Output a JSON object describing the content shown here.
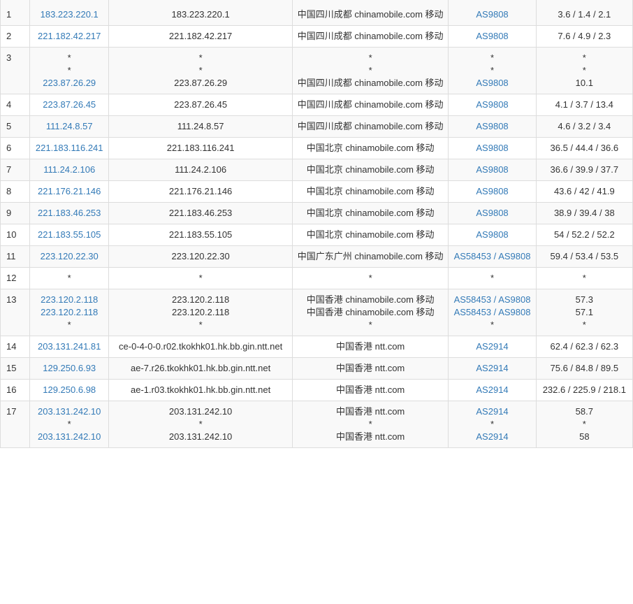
{
  "rows": [
    {
      "hop": "1",
      "ip": [
        "183.223.220.1"
      ],
      "host": [
        "183.223.220.1"
      ],
      "loc": [
        "中国四川成都 chinamobile.com 移动"
      ],
      "asn": [
        "AS9808"
      ],
      "rtt": [
        "3.6 / 1.4 / 2.1"
      ]
    },
    {
      "hop": "2",
      "ip": [
        "221.182.42.217"
      ],
      "host": [
        "221.182.42.217"
      ],
      "loc": [
        "中国四川成都 chinamobile.com 移动"
      ],
      "asn": [
        "AS9808"
      ],
      "rtt": [
        "7.6 / 4.9 / 2.3"
      ]
    },
    {
      "hop": "3",
      "ip": [
        "*",
        "*",
        "223.87.26.29"
      ],
      "host": [
        "*",
        "*",
        "223.87.26.29"
      ],
      "loc": [
        "*",
        "*",
        "中国四川成都 chinamobile.com 移动"
      ],
      "asn": [
        "*",
        "*",
        "AS9808"
      ],
      "rtt": [
        "*",
        "*",
        "10.1"
      ]
    },
    {
      "hop": "4",
      "ip": [
        "223.87.26.45"
      ],
      "host": [
        "223.87.26.45"
      ],
      "loc": [
        "中国四川成都 chinamobile.com 移动"
      ],
      "asn": [
        "AS9808"
      ],
      "rtt": [
        "4.1 / 3.7 / 13.4"
      ]
    },
    {
      "hop": "5",
      "ip": [
        "111.24.8.57"
      ],
      "host": [
        "111.24.8.57"
      ],
      "loc": [
        "中国四川成都 chinamobile.com 移动"
      ],
      "asn": [
        "AS9808"
      ],
      "rtt": [
        "4.6 / 3.2 / 3.4"
      ]
    },
    {
      "hop": "6",
      "ip": [
        "221.183.116.241"
      ],
      "host": [
        "221.183.116.241"
      ],
      "loc": [
        "中国北京 chinamobile.com 移动"
      ],
      "asn": [
        "AS9808"
      ],
      "rtt": [
        "36.5 / 44.4 / 36.6"
      ]
    },
    {
      "hop": "7",
      "ip": [
        "111.24.2.106"
      ],
      "host": [
        "111.24.2.106"
      ],
      "loc": [
        "中国北京 chinamobile.com 移动"
      ],
      "asn": [
        "AS9808"
      ],
      "rtt": [
        "36.6 / 39.9 / 37.7"
      ]
    },
    {
      "hop": "8",
      "ip": [
        "221.176.21.146"
      ],
      "host": [
        "221.176.21.146"
      ],
      "loc": [
        "中国北京 chinamobile.com 移动"
      ],
      "asn": [
        "AS9808"
      ],
      "rtt": [
        "43.6 / 42 / 41.9"
      ]
    },
    {
      "hop": "9",
      "ip": [
        "221.183.46.253"
      ],
      "host": [
        "221.183.46.253"
      ],
      "loc": [
        "中国北京 chinamobile.com 移动"
      ],
      "asn": [
        "AS9808"
      ],
      "rtt": [
        "38.9 / 39.4 / 38"
      ]
    },
    {
      "hop": "10",
      "ip": [
        "221.183.55.105"
      ],
      "host": [
        "221.183.55.105"
      ],
      "loc": [
        "中国北京 chinamobile.com 移动"
      ],
      "asn": [
        "AS9808"
      ],
      "rtt": [
        "54 / 52.2 / 52.2"
      ]
    },
    {
      "hop": "11",
      "ip": [
        "223.120.22.30"
      ],
      "host": [
        "223.120.22.30"
      ],
      "loc": [
        "中国广东广州 chinamobile.com 移动"
      ],
      "asn": [
        "AS58453 / AS9808"
      ],
      "rtt": [
        "59.4 / 53.4 / 53.5"
      ]
    },
    {
      "hop": "12",
      "ip": [
        "*"
      ],
      "host": [
        "*"
      ],
      "loc": [
        "*"
      ],
      "asn": [
        "*"
      ],
      "rtt": [
        "*"
      ]
    },
    {
      "hop": "13",
      "ip": [
        "223.120.2.118",
        "223.120.2.118",
        "*"
      ],
      "host": [
        "223.120.2.118",
        "223.120.2.118",
        "*"
      ],
      "loc": [
        "中国香港 chinamobile.com 移动",
        "中国香港 chinamobile.com 移动",
        "*"
      ],
      "asn": [
        "AS58453 / AS9808",
        "AS58453 / AS9808",
        "*"
      ],
      "rtt": [
        "57.3",
        "57.1",
        "*"
      ]
    },
    {
      "hop": "14",
      "ip": [
        "203.131.241.81"
      ],
      "host": [
        "ce-0-4-0-0.r02.tkokhk01.hk.bb.gin.ntt.net"
      ],
      "loc": [
        "中国香港 ntt.com"
      ],
      "asn": [
        "AS2914"
      ],
      "rtt": [
        "62.4 / 62.3 / 62.3"
      ]
    },
    {
      "hop": "15",
      "ip": [
        "129.250.6.93"
      ],
      "host": [
        "ae-7.r26.tkokhk01.hk.bb.gin.ntt.net"
      ],
      "loc": [
        "中国香港 ntt.com"
      ],
      "asn": [
        "AS2914"
      ],
      "rtt": [
        "75.6 / 84.8 / 89.5"
      ]
    },
    {
      "hop": "16",
      "ip": [
        "129.250.6.98"
      ],
      "host": [
        "ae-1.r03.tkokhk01.hk.bb.gin.ntt.net"
      ],
      "loc": [
        "中国香港 ntt.com"
      ],
      "asn": [
        "AS2914"
      ],
      "rtt": [
        "232.6 / 225.9 / 218.1"
      ]
    },
    {
      "hop": "17",
      "ip": [
        "203.131.242.10",
        "*",
        "203.131.242.10"
      ],
      "host": [
        "203.131.242.10",
        "*",
        "203.131.242.10"
      ],
      "loc": [
        "中国香港 ntt.com",
        "*",
        "中国香港 ntt.com"
      ],
      "asn": [
        "AS2914",
        "*",
        "AS2914"
      ],
      "rtt": [
        "58.7",
        "*",
        "58"
      ]
    }
  ],
  "colors": {
    "link": "#337ab7",
    "text": "#333333",
    "stripe": "#f9f9f9",
    "border": "#dddddd"
  }
}
